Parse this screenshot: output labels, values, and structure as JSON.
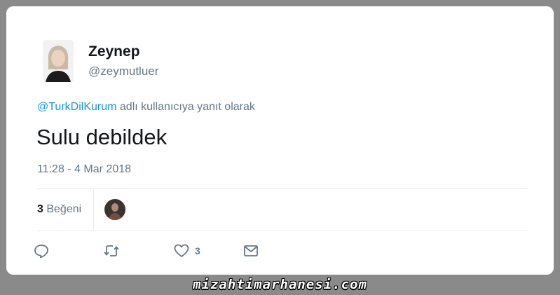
{
  "tweet": {
    "display_name": "Zeynep",
    "handle": "@zeymutluer",
    "reply_to_handle": "@TurkDilKurum",
    "reply_suffix": "adlı kullanıcıya yanıt olarak",
    "text": "Sulu debildek",
    "timestamp": "11:28 - 4 Mar 2018"
  },
  "stats": {
    "like_count": "3",
    "like_label": "Beğeni"
  },
  "actions": {
    "reply_icon": "reply-icon",
    "retweet_icon": "retweet-icon",
    "like_icon": "heart-icon",
    "like_count": "3",
    "dm_icon": "mail-icon"
  },
  "watermark": "mizahtimarhanesi.com",
  "colors": {
    "link": "#1b95e0",
    "secondary_text": "#657786",
    "primary_text": "#14171a",
    "background": "#8a8a8a"
  }
}
